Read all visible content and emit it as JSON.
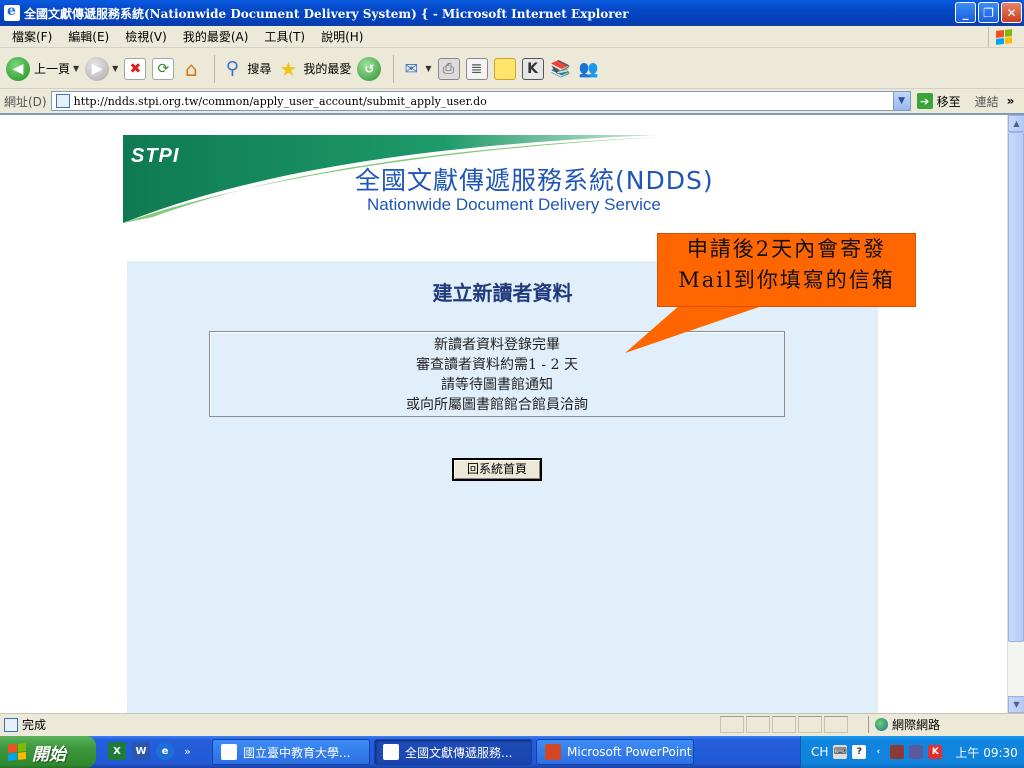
{
  "window": {
    "title": "全國文獻傳遞服務系統(Nationwide Document Delivery System) { - Microsoft Internet Explorer",
    "controls": [
      "minimize",
      "maximize",
      "close"
    ]
  },
  "menu": [
    "檔案(F)",
    "編輯(E)",
    "檢視(V)",
    "我的最愛(A)",
    "工具(T)",
    "說明(H)"
  ],
  "toolbar": {
    "back_label": "上一頁",
    "search_label": "搜尋",
    "favorites_label": "我的最愛"
  },
  "address": {
    "label": "網址(D)",
    "url": "http://ndds.stpi.org.tw/common/apply_user_account/submit_apply_user.do",
    "go_label": "移至",
    "links_label": "連結",
    "more": "»"
  },
  "banner": {
    "logo": "STPI",
    "title_zh": "全國文獻傳遞服務系統(NDDS)",
    "title_en": "Nationwide Document Delivery Service"
  },
  "page": {
    "heading": "建立新讀者資料",
    "messages": [
      "新讀者資料登錄完畢",
      "審查讀者資料約需1 - 2 天",
      "請等待圖書館通知",
      "或向所屬圖書館館合館員洽詢"
    ],
    "home_button": "回系統首頁"
  },
  "callout": {
    "lines": [
      "申請後2天內會寄發",
      "Mail到你填寫的信箱"
    ],
    "color": "#ff6600"
  },
  "status": {
    "text": "完成",
    "zone": "網際網路"
  },
  "taskbar": {
    "start_label": "開始",
    "quick_more": "»",
    "tasks": [
      "國立臺中教育大學...",
      "全國文獻傳遞服務...",
      "Microsoft PowerPoint ..."
    ],
    "language": "CH",
    "clock": "上午 09:30"
  }
}
